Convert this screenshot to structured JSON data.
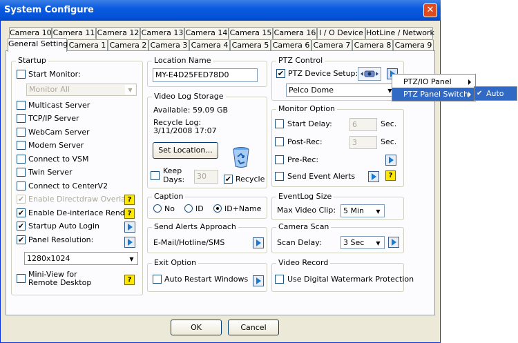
{
  "window": {
    "title": "System Configure",
    "close_glyph": "✕"
  },
  "tabs": {
    "row1": [
      "Camera 10",
      "Camera 11",
      "Camera 12",
      "Camera 13",
      "Camera 14",
      "Camera 15",
      "Camera 16",
      "I / O Device",
      "HotLine / Network"
    ],
    "row2": [
      "General Setting",
      "Camera 1",
      "Camera 2",
      "Camera 3",
      "Camera 4",
      "Camera 5",
      "Camera 6",
      "Camera 7",
      "Camera 8",
      "Camera 9"
    ],
    "active": "General Setting"
  },
  "startup": {
    "title": "Startup",
    "start_monitor": "Start Monitor:",
    "monitor_select": "Monitor All",
    "items": [
      {
        "label": "Multicast Server",
        "checked": false,
        "enabled": true
      },
      {
        "label": "TCP/IP Server",
        "checked": false,
        "enabled": true
      },
      {
        "label": "WebCam Server",
        "checked": false,
        "enabled": true
      },
      {
        "label": "Modem Server",
        "checked": false,
        "enabled": true
      },
      {
        "label": "Connect to VSM",
        "checked": false,
        "enabled": true
      },
      {
        "label": "Twin Server",
        "checked": false,
        "enabled": true
      },
      {
        "label": "Connect to CenterV2",
        "checked": false,
        "enabled": true
      },
      {
        "label": "Enable Directdraw Overlay",
        "checked": true,
        "enabled": false
      },
      {
        "label": "Enable De-interlace Render",
        "checked": true,
        "enabled": true
      },
      {
        "label": "Startup Auto Login",
        "checked": true,
        "enabled": true
      },
      {
        "label": "Panel Resolution:",
        "checked": true,
        "enabled": true
      }
    ],
    "resolution": "1280x1024",
    "miniview_line1": "Mini-View for",
    "miniview_line2": "Remote Desktop"
  },
  "location": {
    "title": "Location Name",
    "value": "MY-E4D25FED78D0"
  },
  "video_log": {
    "title": "Video Log Storage",
    "available": "Available: 59.09 GB",
    "recycle_log": "Recycle Log:",
    "recycle_date": "3/11/2008 17:07",
    "set_location": "Set Location...",
    "keep": "Keep",
    "days": "Days:",
    "days_value": "30",
    "recycle": "Recycle"
  },
  "caption": {
    "title": "Caption",
    "options": [
      "No",
      "ID",
      "ID+Name"
    ],
    "selected": "ID+Name"
  },
  "send_alerts": {
    "title": "Send Alerts Approach",
    "value": "E-Mail/Hotline/SMS"
  },
  "exit_option": {
    "title": "Exit Option",
    "auto_restart": "Auto Restart Windows"
  },
  "ptz": {
    "title": "PTZ Control",
    "device_setup": "PTZ Device Setup:",
    "device": "Pelco Dome"
  },
  "monitor_option": {
    "title": "Monitor Option",
    "start_delay": "Start Delay:",
    "start_delay_value": "6",
    "post_rec": "Post-Rec:",
    "post_rec_value": "3",
    "sec": "Sec.",
    "pre_rec": "Pre-Rec:",
    "send_event_alerts": "Send Event Alerts"
  },
  "eventlog": {
    "title": "EventLog Size",
    "max_clip": "Max Video Clip:",
    "value": "5 Min"
  },
  "camera_scan": {
    "title": "Camera Scan",
    "scan_delay": "Scan Delay:",
    "value": "3 Sec"
  },
  "video_record": {
    "title": "Video Record",
    "watermark": "Use Digital Watermark Protection"
  },
  "footer": {
    "ok": "OK",
    "cancel": "Cancel"
  },
  "context_menu": {
    "items": [
      "PTZ/IO Panel",
      "PTZ Panel Switch"
    ],
    "submenu_item": "Auto",
    "check_glyph": "✔"
  },
  "glyphs": {
    "check": "✔",
    "arrow_down": "▼",
    "help": "?"
  }
}
